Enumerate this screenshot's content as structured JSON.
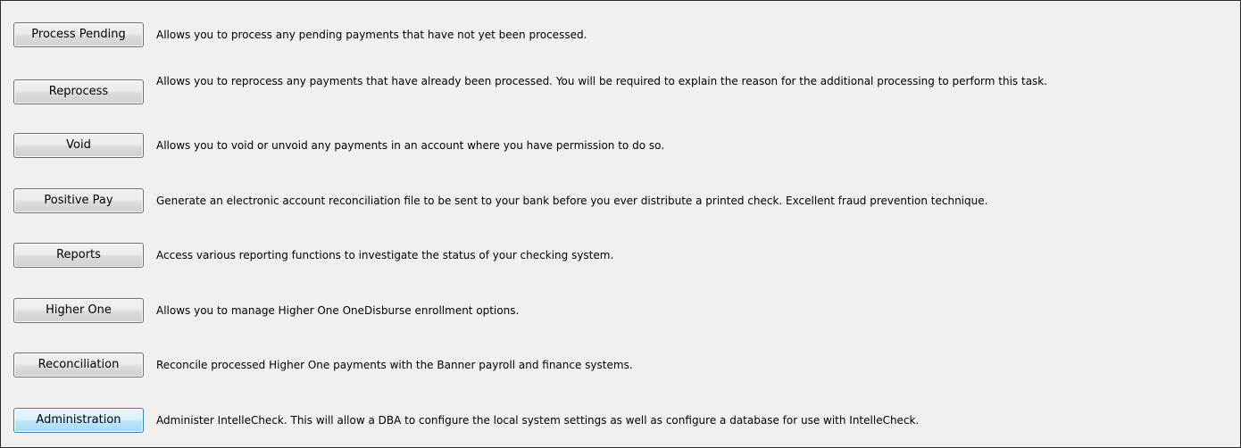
{
  "actions": [
    {
      "label": "Process Pending",
      "description": "Allows you to process any pending payments that have not yet been processed."
    },
    {
      "label": "Reprocess",
      "description": "Allows you to reprocess any payments that have already been processed.  You will be required to explain the reason for the additional processing to perform this task."
    },
    {
      "label": "Void",
      "description": "Allows you to void or unvoid any payments in an account where you have permission to do so."
    },
    {
      "label": "Positive Pay",
      "description": "Generate an electronic account reconciliation file to be sent to your bank before you ever distribute a printed check.  Excellent fraud prevention technique."
    },
    {
      "label": "Reports",
      "description": "Access various reporting functions to investigate the status of your checking system."
    },
    {
      "label": "Higher One",
      "description": "Allows you to manage Higher One OneDisburse enrollment options."
    },
    {
      "label": "Reconciliation",
      "description": "Reconcile processed Higher One payments with the Banner payroll and finance systems."
    },
    {
      "label": "Administration",
      "description": "Administer IntelleCheck.  This will allow a DBA to configure the local system settings as well as configure a database for use with IntelleCheck."
    }
  ]
}
